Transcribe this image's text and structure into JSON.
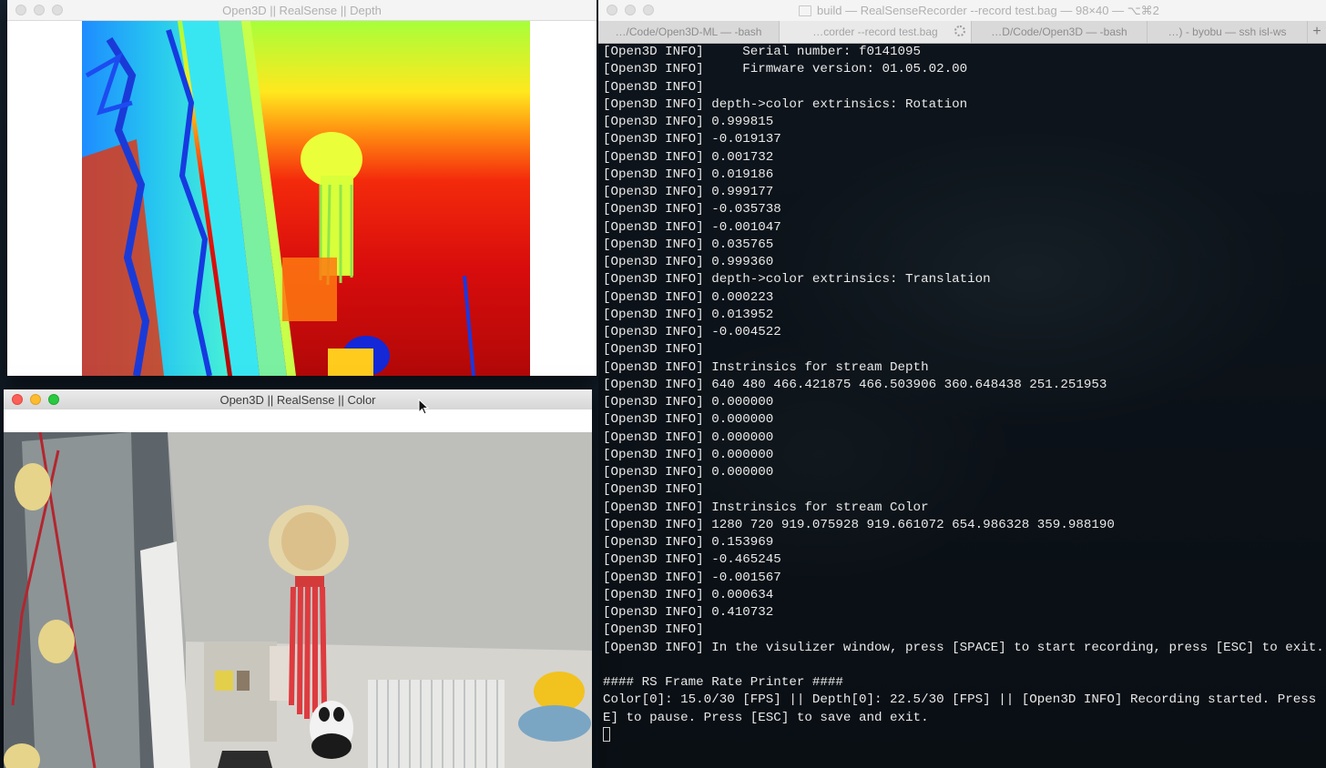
{
  "depth_window": {
    "title": "Open3D || RealSense || Depth"
  },
  "color_window": {
    "title": "Open3D || RealSense || Color"
  },
  "terminal_window": {
    "title": "build — RealSenseRecorder --record test.bag — 98×40 — ⌥⌘2",
    "tabs": [
      {
        "label": "…/Code/Open3D-ML — -bash"
      },
      {
        "label": "…corder --record test.bag"
      },
      {
        "label": "…D/Code/Open3D — -bash"
      },
      {
        "label": "…) - byobu — ssh isl-ws"
      }
    ],
    "new_tab_label": "+",
    "lines": [
      "[Open3D INFO]     Serial number: f0141095",
      "[Open3D INFO]     Firmware version: 01.05.02.00",
      "[Open3D INFO]",
      "[Open3D INFO] depth->color extrinsics: Rotation",
      "[Open3D INFO] 0.999815",
      "[Open3D INFO] -0.019137",
      "[Open3D INFO] 0.001732",
      "[Open3D INFO] 0.019186",
      "[Open3D INFO] 0.999177",
      "[Open3D INFO] -0.035738",
      "[Open3D INFO] -0.001047",
      "[Open3D INFO] 0.035765",
      "[Open3D INFO] 0.999360",
      "[Open3D INFO] depth->color extrinsics: Translation",
      "[Open3D INFO] 0.000223",
      "[Open3D INFO] 0.013952",
      "[Open3D INFO] -0.004522",
      "[Open3D INFO]",
      "[Open3D INFO] Instrinsics for stream Depth",
      "[Open3D INFO] 640 480 466.421875 466.503906 360.648438 251.251953",
      "[Open3D INFO] 0.000000",
      "[Open3D INFO] 0.000000",
      "[Open3D INFO] 0.000000",
      "[Open3D INFO] 0.000000",
      "[Open3D INFO] 0.000000",
      "[Open3D INFO]",
      "[Open3D INFO] Instrinsics for stream Color",
      "[Open3D INFO] 1280 720 919.075928 919.661072 654.986328 359.988190",
      "[Open3D INFO] 0.153969",
      "[Open3D INFO] -0.465245",
      "[Open3D INFO] -0.001567",
      "[Open3D INFO] 0.000634",
      "[Open3D INFO] 0.410732",
      "[Open3D INFO]",
      "[Open3D INFO] In the visulizer window, press [SPACE] to start recording, press [ESC] to exit.",
      "",
      "#### RS Frame Rate Printer ####",
      "Color[0]: 15.0/30 [FPS] || Depth[0]: 22.5/30 [FPS] || [Open3D INFO] Recording started. Press [SPAC",
      "E] to pause. Press [ESC] to save and exit."
    ]
  },
  "colors": {
    "close": "#fc5f57",
    "minimize": "#fdbc2e",
    "zoom": "#29c940",
    "terminal_text": "#e9e9e9"
  }
}
